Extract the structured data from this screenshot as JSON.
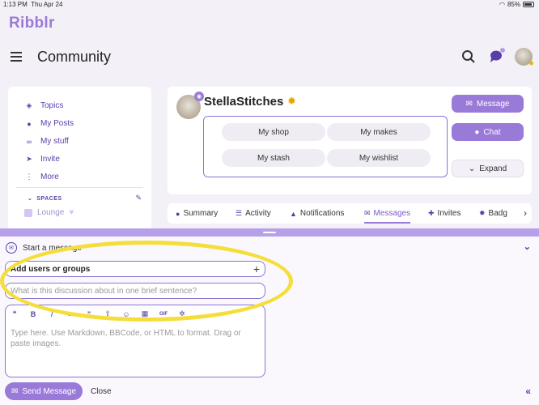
{
  "status": {
    "time": "1:13 PM",
    "date": "Thu Apr 24",
    "battery": "85%"
  },
  "app": {
    "logo": "Ribblr"
  },
  "header": {
    "title": "Community"
  },
  "sidebar": {
    "items": [
      {
        "label": "Topics",
        "icon": "layers-icon"
      },
      {
        "label": "My Posts",
        "icon": "user-icon"
      },
      {
        "label": "My stuff",
        "icon": "link-icon"
      },
      {
        "label": "Invite",
        "icon": "send-icon"
      },
      {
        "label": "More",
        "icon": "more-vertical-icon"
      }
    ],
    "spaces_label": "SPACES",
    "lounge": "Lounge"
  },
  "profile": {
    "username": "StellaStitches",
    "links": [
      "My shop",
      "My makes",
      "My stash",
      "My wishlist"
    ],
    "actions": {
      "message": "Message",
      "chat": "Chat",
      "expand": "Expand"
    }
  },
  "tabs": [
    {
      "label": "Summary",
      "icon": "user-icon"
    },
    {
      "label": "Activity",
      "icon": "list-icon"
    },
    {
      "label": "Notifications",
      "icon": "bell-icon"
    },
    {
      "label": "Messages",
      "icon": "envelope-icon",
      "active": true
    },
    {
      "label": "Invites",
      "icon": "user-plus-icon"
    },
    {
      "label": "Badg",
      "icon": "badge-icon"
    }
  ],
  "composer": {
    "title": "Start a message",
    "add_users": "Add users or groups",
    "title_placeholder": "What is this discussion about in one brief sentence?",
    "body_placeholder": "Type here. Use Markdown, BBCode, or HTML to format. Drag or paste images.",
    "send": "Send Message",
    "close": "Close",
    "toolbar": [
      "quote",
      "B",
      "I",
      "link",
      "”",
      "upload",
      "emoji",
      "calendar",
      "GIF",
      "gear"
    ]
  },
  "colors": {
    "accent": "#9a7ad8",
    "accent_dark": "#5a3ea8",
    "highlight": "#f5de3a"
  }
}
